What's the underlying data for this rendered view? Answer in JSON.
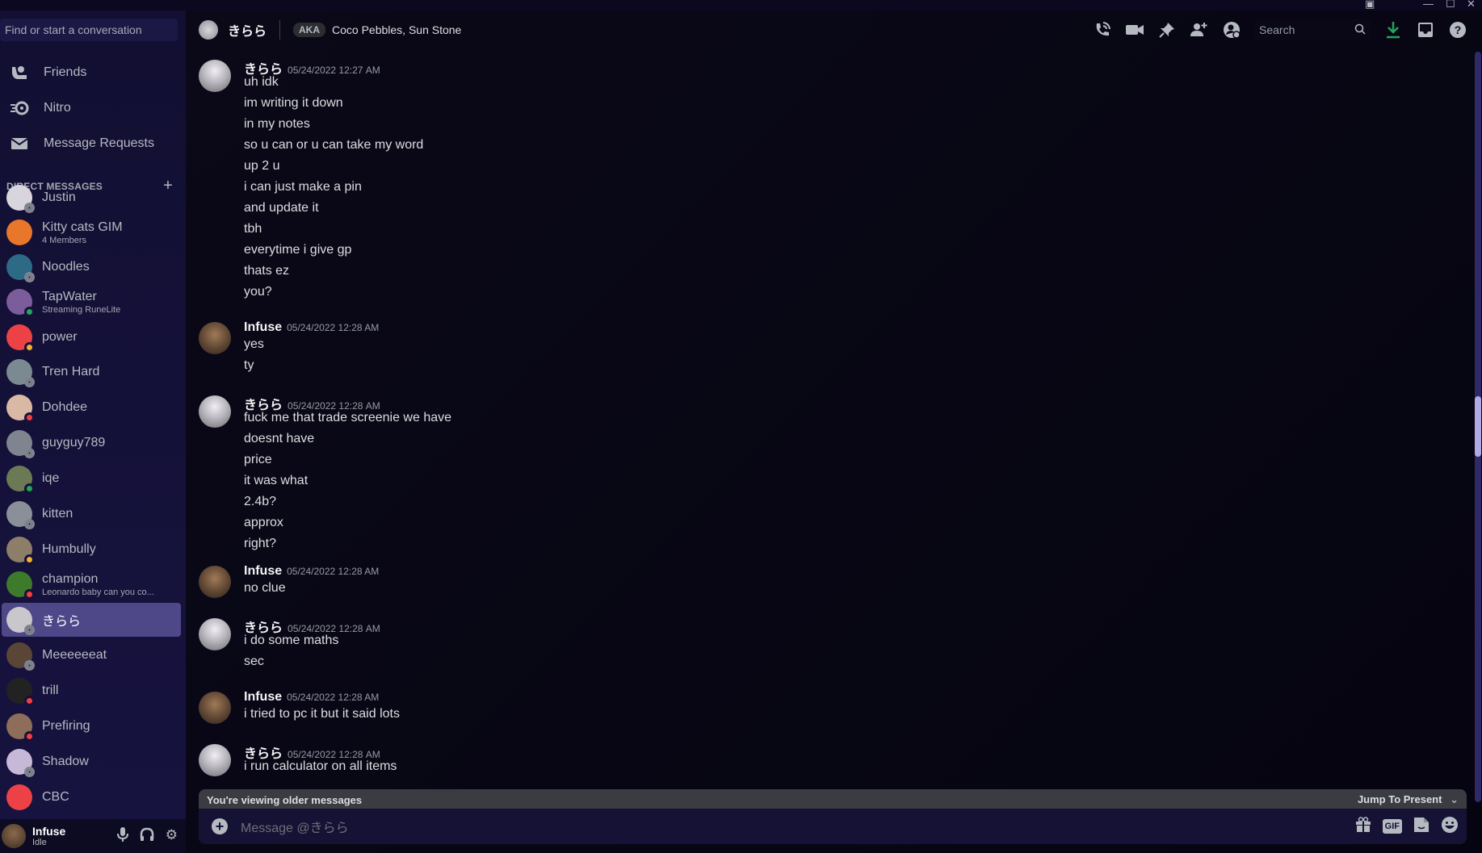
{
  "window": {
    "controls": [
      "minimize",
      "maximize",
      "close"
    ]
  },
  "sidebar": {
    "search_placeholder": "Find or start a conversation",
    "nav": [
      {
        "label": "Friends",
        "icon": "friends-icon"
      },
      {
        "label": "Nitro",
        "icon": "nitro-icon"
      },
      {
        "label": "Message Requests",
        "icon": "envelope-icon"
      }
    ],
    "dm_header": "DIRECT MESSAGES",
    "dms": [
      {
        "name": "Justin",
        "sub": "",
        "status": "offline",
        "color": "#d9d5dc"
      },
      {
        "name": "Kitty cats GIM",
        "sub": "4 Members",
        "status": "",
        "color": "#e8762b"
      },
      {
        "name": "Noodles",
        "sub": "",
        "status": "offline",
        "color": "#2c6a86"
      },
      {
        "name": "TapWater",
        "sub": "Streaming RuneLite",
        "status": "online",
        "color": "#7a5d9a"
      },
      {
        "name": "power",
        "sub": "",
        "status": "idle",
        "color": "#ed4245"
      },
      {
        "name": "Tren Hard",
        "sub": "",
        "status": "offline",
        "color": "#7b8a90"
      },
      {
        "name": "Dohdee",
        "sub": "",
        "status": "dnd",
        "color": "#d9b8a4"
      },
      {
        "name": "guyguy789",
        "sub": "",
        "status": "offline",
        "color": "#80848e"
      },
      {
        "name": "iqe",
        "sub": "",
        "status": "online",
        "color": "#6b7a55"
      },
      {
        "name": "kitten",
        "sub": "",
        "status": "offline",
        "color": "#8a8f98"
      },
      {
        "name": "Humbully",
        "sub": "",
        "status": "idle",
        "color": "#8d7e6a"
      },
      {
        "name": "champion",
        "sub": "Leonardo baby can you co...",
        "status": "dnd",
        "color": "#3d7a2b"
      },
      {
        "name": "きらら",
        "sub": "",
        "status": "offline",
        "color": "#c9c6cc",
        "active": true
      },
      {
        "name": "Meeeeeeat",
        "sub": "",
        "status": "offline",
        "color": "#5a4636"
      },
      {
        "name": "trill",
        "sub": "",
        "status": "dnd",
        "color": "#222222"
      },
      {
        "name": "Prefiring",
        "sub": "",
        "status": "dnd",
        "color": "#8e6d5a"
      },
      {
        "name": "Shadow",
        "sub": "",
        "status": "offline",
        "color": "#c8b8d8"
      },
      {
        "name": "CBC",
        "sub": "",
        "status": "",
        "color": "#ed4245"
      }
    ],
    "user": {
      "name": "Infuse",
      "status": "Idle"
    }
  },
  "header": {
    "title": "きらら",
    "aka_label": "AKA",
    "aka_names": "Coco Pebbles, Sun Stone",
    "search_placeholder": "Search"
  },
  "messages": [
    {
      "author": "きらら",
      "avatar": "kirara",
      "time": "05/24/2022 12:27 AM",
      "lines": [
        "uh idk",
        "im writing it down",
        "in my notes",
        "so u can or u can take my word",
        "up 2 u",
        "i can just make a pin",
        "and update it",
        "tbh",
        "everytime i give gp",
        "thats ez",
        "you?"
      ]
    },
    {
      "author": "Infuse",
      "avatar": "infuse",
      "time": "05/24/2022 12:28 AM",
      "lines": [
        "yes",
        "ty"
      ]
    },
    {
      "author": "きらら",
      "avatar": "kirara",
      "time": "05/24/2022 12:28 AM",
      "lines": [
        "fuck me that trade screenie we have",
        "doesnt have",
        "price",
        "it was what",
        "2.4b?",
        "approx",
        "right?"
      ]
    },
    {
      "author": "Infuse",
      "avatar": "infuse",
      "time": "05/24/2022 12:28 AM",
      "lines": [
        "no clue"
      ]
    },
    {
      "author": "きらら",
      "avatar": "kirara",
      "time": "05/24/2022 12:28 AM",
      "lines": [
        "i do some maths",
        "sec"
      ]
    },
    {
      "author": "Infuse",
      "avatar": "infuse",
      "time": "05/24/2022 12:28 AM",
      "lines": [
        "i tried to pc it but it said lots"
      ]
    },
    {
      "author": "きらら",
      "avatar": "kirara",
      "time": "05/24/2022 12:28 AM",
      "lines": [
        "i run calculator on all items"
      ]
    }
  ],
  "older_bar": {
    "text": "You're viewing older messages",
    "jump": "Jump To Present"
  },
  "composer": {
    "placeholder": "Message @きらら",
    "gif_label": "GIF"
  },
  "colors": {
    "accent_download": "#23a55a",
    "active_dm": "#4e4788"
  }
}
